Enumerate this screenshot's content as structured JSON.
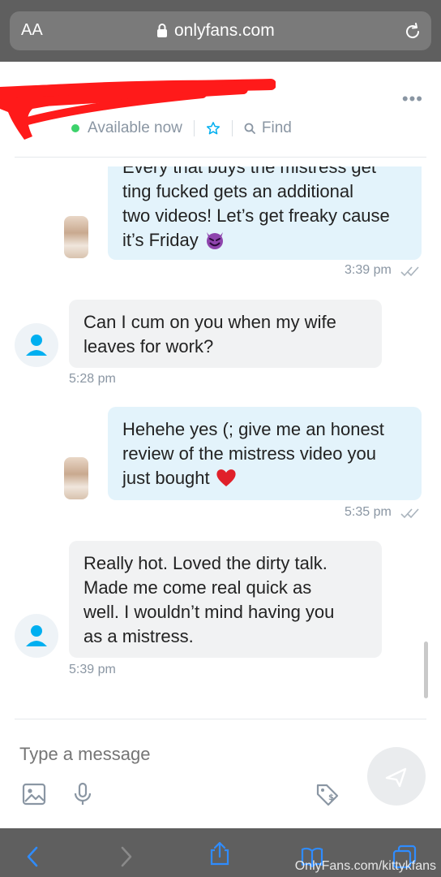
{
  "browser": {
    "aa_label": "AA",
    "url": "onlyfans.com",
    "watermark": "OnlyFans.com/kittykfans"
  },
  "header": {
    "status": "Available now",
    "find_label": "Find"
  },
  "messages": [
    {
      "direction": "out",
      "lines": [
        "Every that buys the mistress get",
        "ting fucked gets an additional",
        "two videos! Let’s get freaky cause",
        "it’s Friday"
      ],
      "emoji": "smiling-devil-emoji",
      "time": "3:39 pm"
    },
    {
      "direction": "in",
      "lines": [
        "Can I cum on you when my wife",
        "leaves for work?"
      ],
      "time": "5:28 pm"
    },
    {
      "direction": "out",
      "lines": [
        "Hehehe yes (; give me an honest",
        "review of the mistress video you",
        "just bought"
      ],
      "emoji": "red-heart-emoji",
      "time": "5:35 pm"
    },
    {
      "direction": "in",
      "lines": [
        "Really hot. Loved the dirty talk.",
        "Made me come real quick as",
        "well. I wouldn’t mind having you",
        "as a mistress."
      ],
      "time": "5:39 pm"
    }
  ],
  "composer": {
    "placeholder": "Type a message"
  },
  "colors": {
    "accent": "#00aff0",
    "online": "#3dd26b",
    "out_bubble": "#e3f3fb",
    "in_bubble": "#f1f2f3",
    "meta_text": "#8a96a3",
    "browser_chrome": "#5f5f5f",
    "redaction": "#ff1a1a"
  }
}
